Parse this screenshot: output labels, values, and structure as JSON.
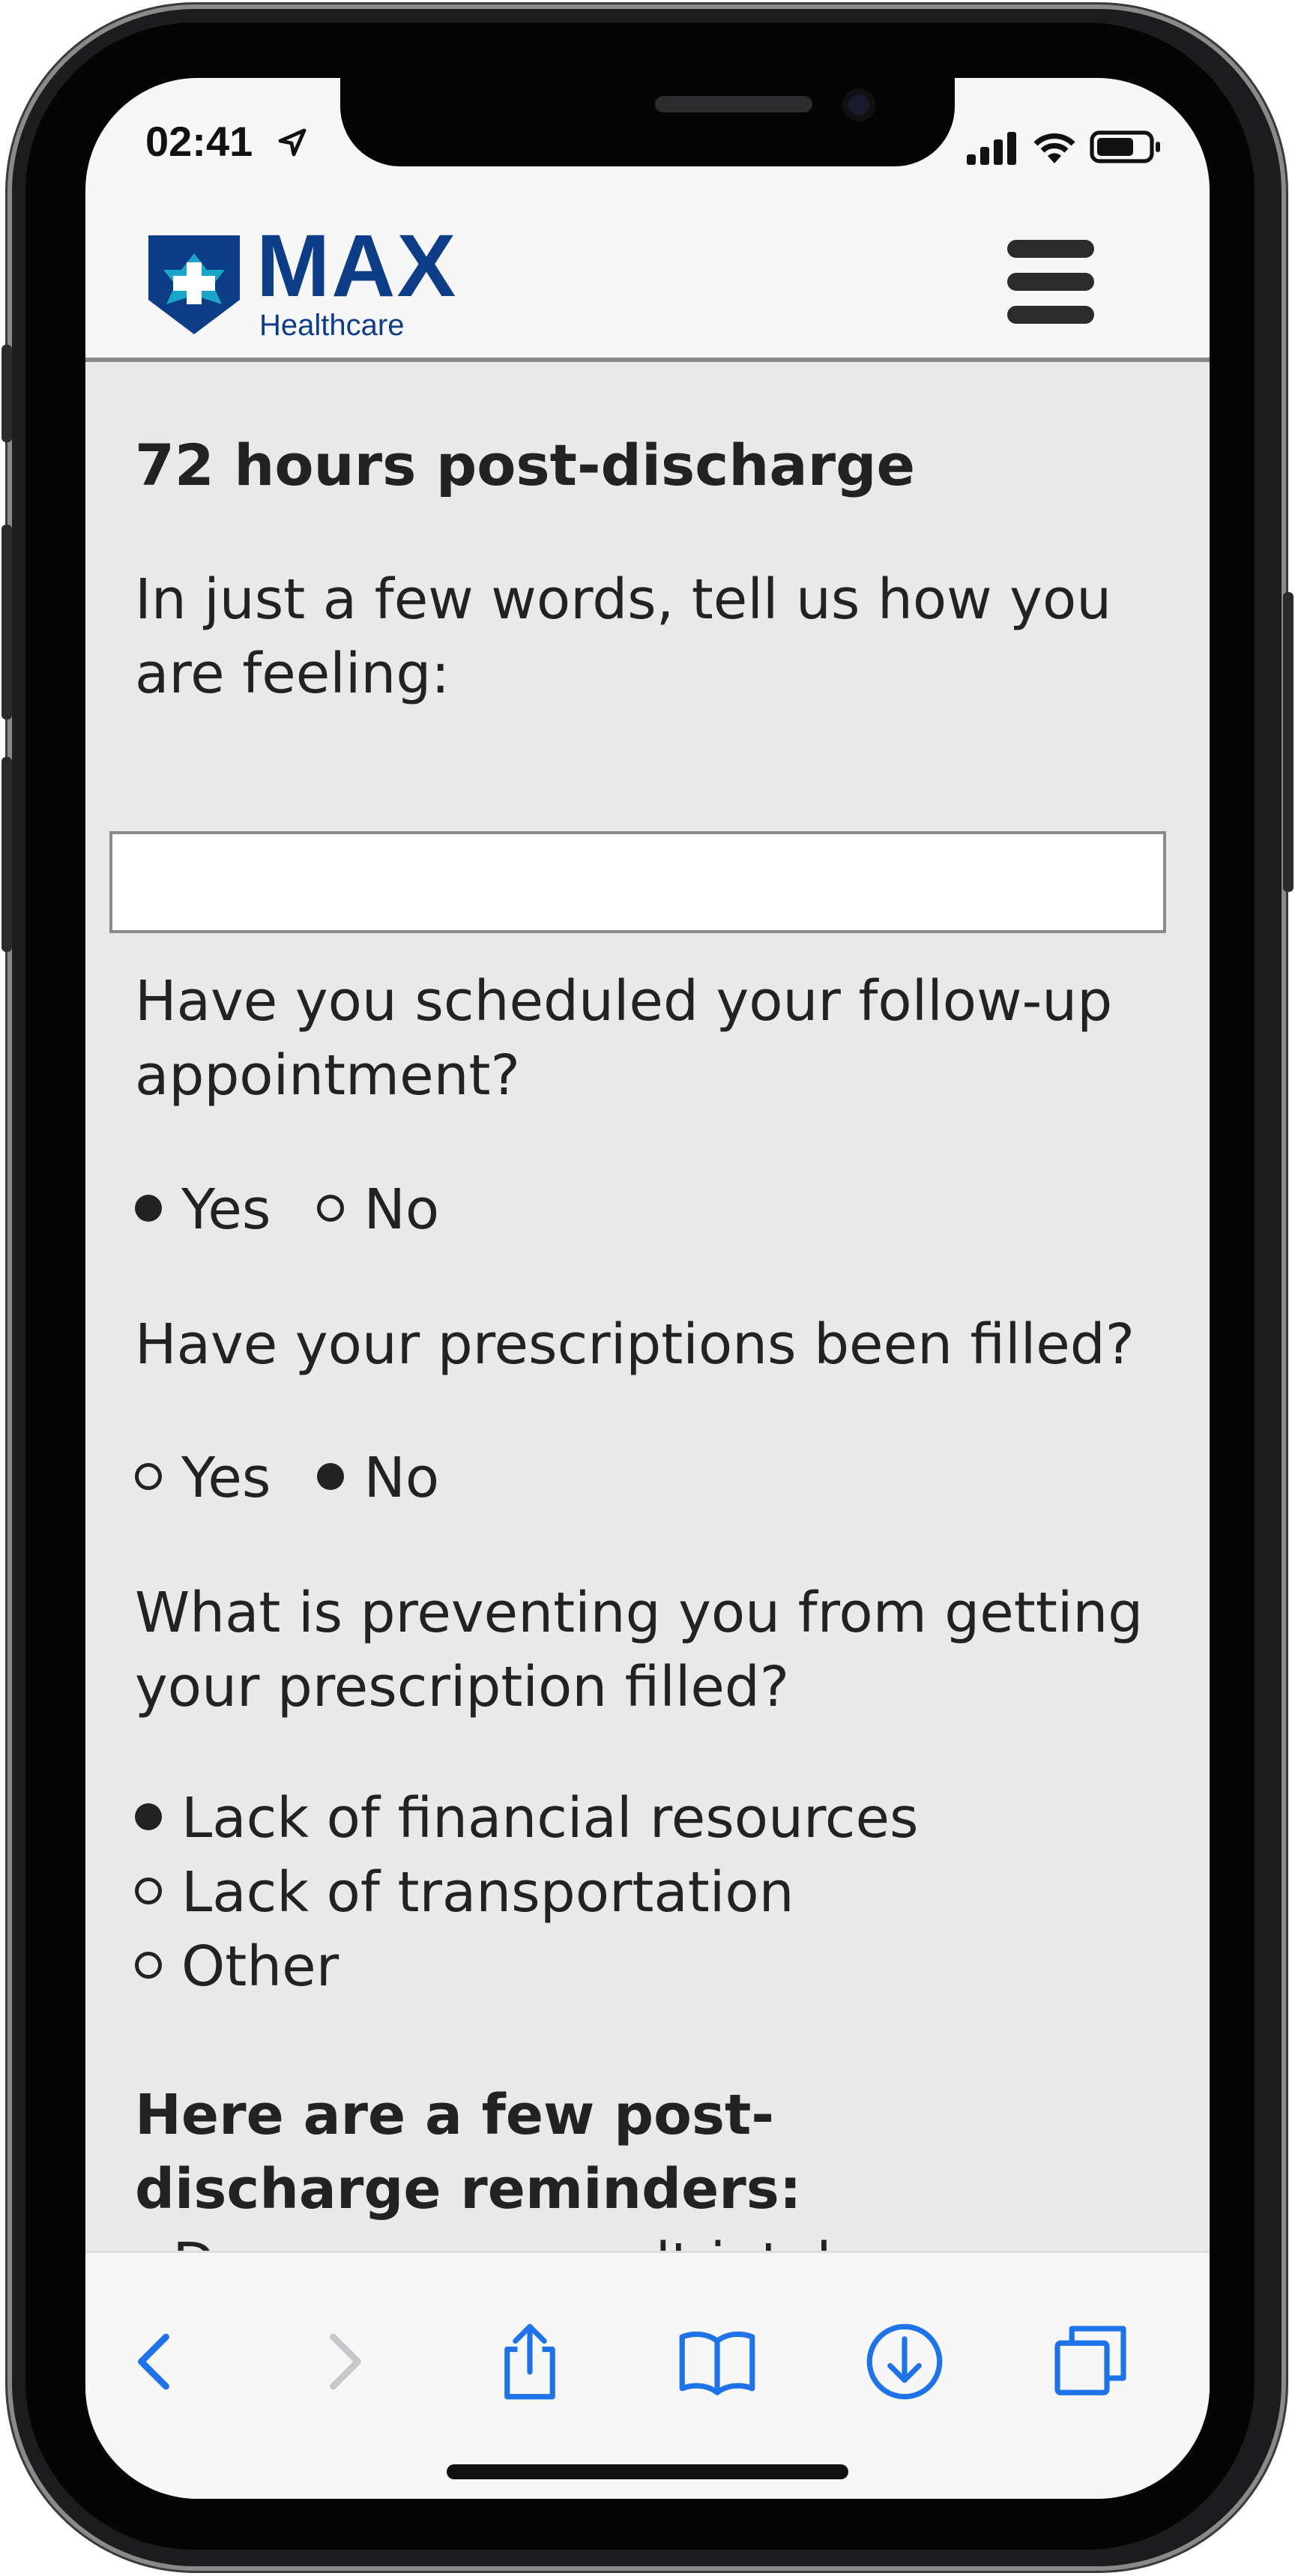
{
  "status_bar": {
    "time": "02:41",
    "icons": [
      "location-arrow-icon",
      "signal-icon",
      "wifi-icon",
      "battery-icon"
    ]
  },
  "header": {
    "brand": "MAX",
    "brand_sub": "Healthcare",
    "logo_icon": "max-healthcare-logo",
    "menu_icon": "hamburger-menu-icon"
  },
  "colors": {
    "brand_blue": "#0d3d86",
    "logo_teal": "#1aa6c8",
    "ios_blue": "#1e73e8",
    "content_bg": "#e9e9e9"
  },
  "form": {
    "title": "72 hours post-discharge",
    "q_feeling": "In just a few words, tell us how you are feeling:",
    "feeling_value": "",
    "q_followup": "Have you scheduled your follow-up appointment?",
    "followup_options": [
      {
        "label": "Yes",
        "selected": true
      },
      {
        "label": "No",
        "selected": false
      }
    ],
    "q_prescriptions": "Have your prescriptions been filled?",
    "prescription_options": [
      {
        "label": "Yes",
        "selected": false
      },
      {
        "label": "No",
        "selected": true
      }
    ],
    "q_preventing": "What is preventing you from getting your prescription filled?",
    "preventing_options": [
      {
        "label": "Lack of financial resources",
        "selected": true
      },
      {
        "label": "Lack of transportation",
        "selected": false
      },
      {
        "label": "Other",
        "selected": false
      }
    ],
    "reminders_heading": "Here are a few post-discharge reminders:",
    "reminders": [
      "- Decrease your salt intake"
    ]
  },
  "toolbar": {
    "items": [
      "back-icon",
      "forward-icon",
      "share-icon",
      "bookmarks-icon",
      "downloads-icon",
      "tabs-icon"
    ]
  }
}
